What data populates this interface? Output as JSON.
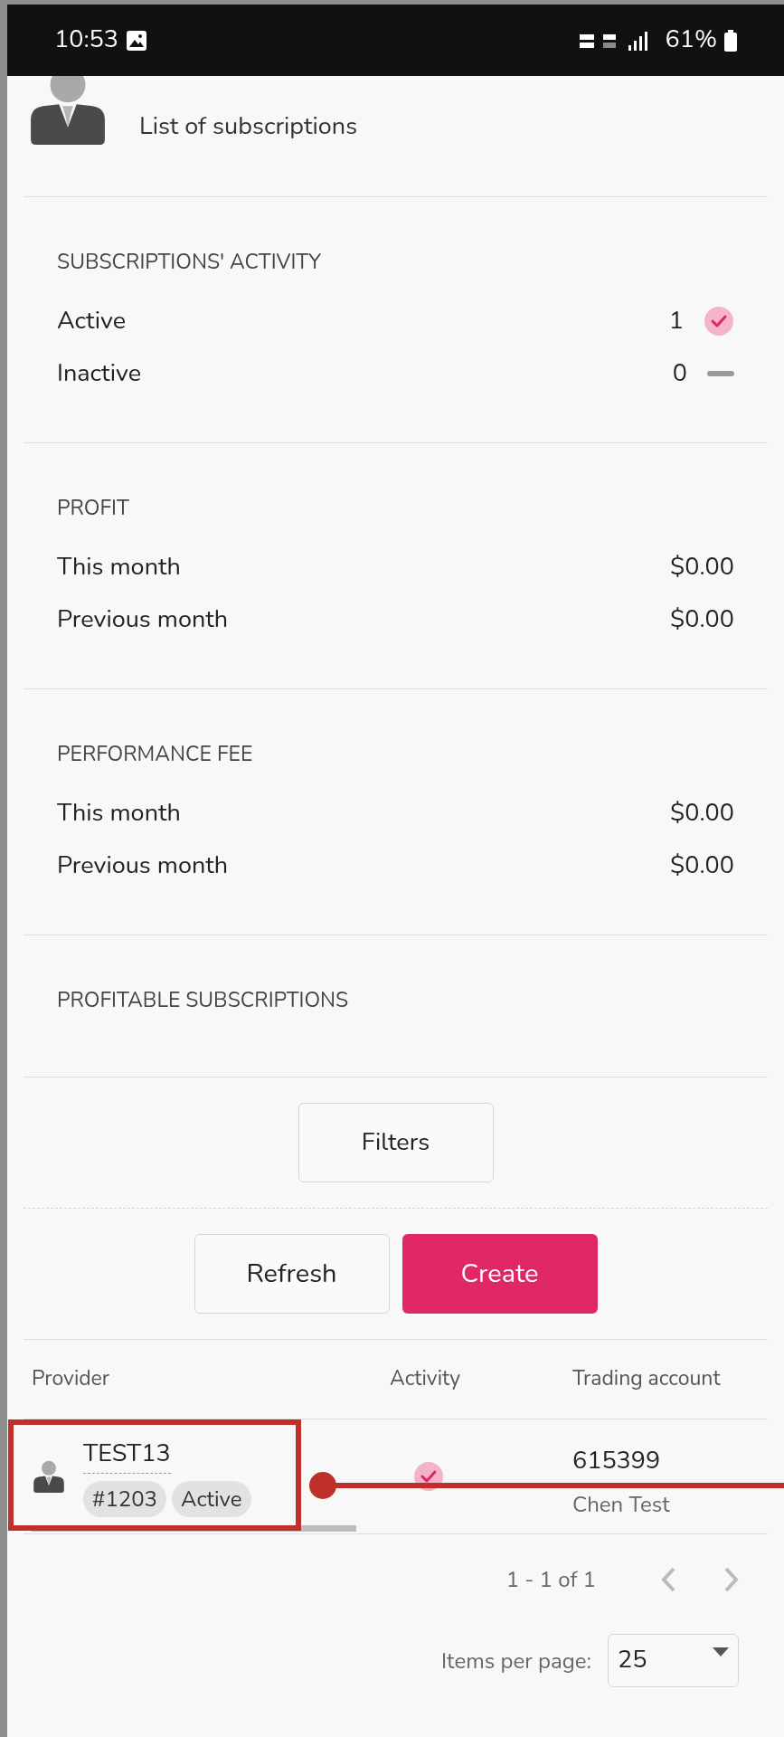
{
  "status_bar": {
    "time": "10:53",
    "battery": "61%"
  },
  "header": {
    "subtitle": "List of subscriptions"
  },
  "sections": [
    {
      "title": "SUBSCRIPTIONS' ACTIVITY",
      "rows": [
        {
          "label": "Active",
          "value": "1",
          "kind": "check"
        },
        {
          "label": "Inactive",
          "value": "0",
          "kind": "dash"
        }
      ]
    },
    {
      "title": "PROFIT",
      "rows": [
        {
          "label": "This month",
          "value": "$0.00"
        },
        {
          "label": "Previous month",
          "value": "$0.00"
        }
      ]
    },
    {
      "title": "PERFORMANCE FEE",
      "rows": [
        {
          "label": "This month",
          "value": "$0.00"
        },
        {
          "label": "Previous month",
          "value": "$0.00"
        }
      ]
    },
    {
      "title": "PROFITABLE SUBSCRIPTIONS"
    }
  ],
  "filters_button": "Filters",
  "actions": [
    "Refresh",
    "Create"
  ],
  "table": {
    "columns": [
      "Provider",
      "Activity",
      "Trading account"
    ],
    "rows": [
      {
        "provider": "TEST13",
        "tags": [
          "#1203",
          "Active"
        ],
        "active": true,
        "account": "615399",
        "owner": "Chen Test"
      }
    ]
  },
  "pagination": {
    "range": "1 - 1 of 1",
    "items_per_page_label": "Items per page:",
    "items_per_page": "25"
  }
}
